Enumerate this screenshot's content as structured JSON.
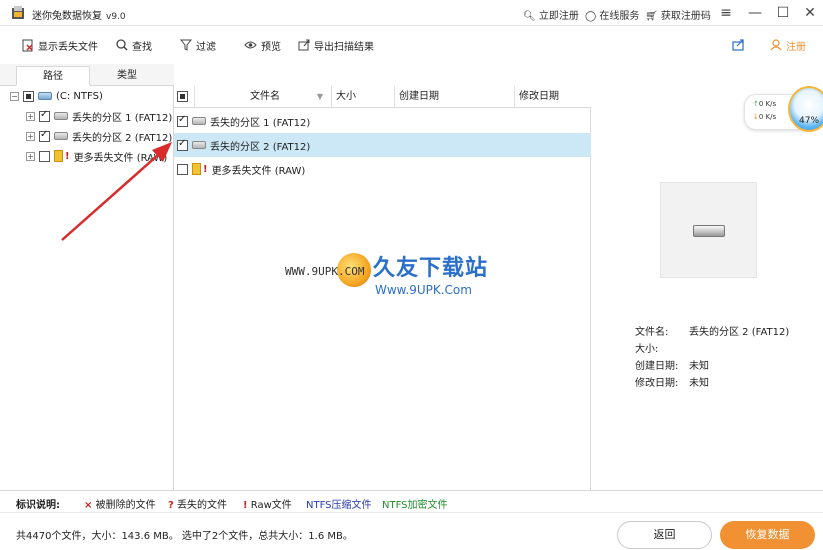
{
  "titlebar": {
    "app_name": "迷你兔数据恢复",
    "version": "v9.0",
    "register_now": "立即注册",
    "online_service": "在线服务",
    "get_code": "获取注册码"
  },
  "toolbar": {
    "show_lost": "显示丢失文件",
    "find": "查找",
    "filter": "过滤",
    "preview": "预览",
    "export": "导出扫描结果",
    "register": "注册"
  },
  "tabs": {
    "path": "路径",
    "type": "类型"
  },
  "tree": {
    "root": "(C: NTFS)",
    "items": [
      "丢失的分区 1 (FAT12)",
      "丢失的分区 2 (FAT12)",
      "更多丢失文件 (RAW)"
    ]
  },
  "filelist": {
    "columns": [
      "文件名",
      "大小",
      "创建日期",
      "修改日期"
    ],
    "rows": [
      "丢失的分区 1 (FAT12)",
      "丢失的分区 2 (FAT12)",
      "更多丢失文件 (RAW)"
    ]
  },
  "speed": {
    "up": "0  K/s",
    "down": "0  K/s",
    "percent": "47%"
  },
  "watermark": {
    "url1": "WWW.9UPK.COM",
    "title": "久友下载站",
    "url2": "Www.9UPK.Com"
  },
  "preview": {
    "name_label": "文件名:",
    "name_value": "丢失的分区 2 (FAT12)",
    "size_label": "大小:",
    "size_value": "",
    "created_label": "创建日期:",
    "created_value": "未知",
    "modified_label": "修改日期:",
    "modified_value": "未知"
  },
  "legend": {
    "title": "标识说明:",
    "deleted": "被删除的文件",
    "lost": "丢失的文件",
    "raw": "Raw文件",
    "ntfs_compressed": "NTFS压缩文件",
    "ntfs_encrypted": "NTFS加密文件"
  },
  "status": {
    "summary": "共4470个文件，大小：143.6 MB。 选中了2个文件，总共大小：1.6 MB。",
    "back": "返回",
    "recover": "恢复数据"
  },
  "colors": {
    "accent": "#f29134",
    "selection": "#cce8f7",
    "arrow": "#d92b2b",
    "ntfs_compressed": "#2a3aa8",
    "ntfs_encrypted": "#1e8c2a"
  }
}
